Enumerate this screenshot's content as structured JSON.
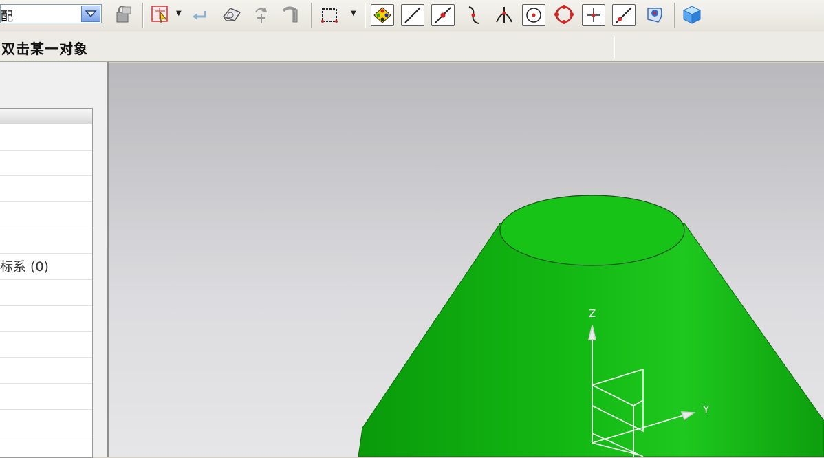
{
  "toolbar": {
    "filter_value": "配",
    "icons": [
      "lock-icon",
      "snap-select-icon",
      "undo-icon",
      "eraser-icon",
      "rotate-icon",
      "magnet-icon",
      "rectangle-select-icon",
      "select-all-icon",
      "line-icon",
      "point-on-line-icon",
      "curve-icon",
      "intersection-icon",
      "circle-center-icon",
      "quadrant-icon",
      "crosshair-icon",
      "tangent-icon",
      "face-icon",
      "cube-icon"
    ]
  },
  "status": {
    "prompt": "双击某一对象"
  },
  "tree": {
    "rows": [
      "",
      "",
      "",
      "",
      "",
      "标系 (0)",
      "",
      "",
      "",
      "",
      "",
      ""
    ]
  },
  "viewport": {
    "axes": {
      "z": "Z",
      "y": "Y"
    },
    "colors": {
      "model": "#12b512",
      "model_top": "#16c316",
      "axes": "#ffffff"
    }
  }
}
